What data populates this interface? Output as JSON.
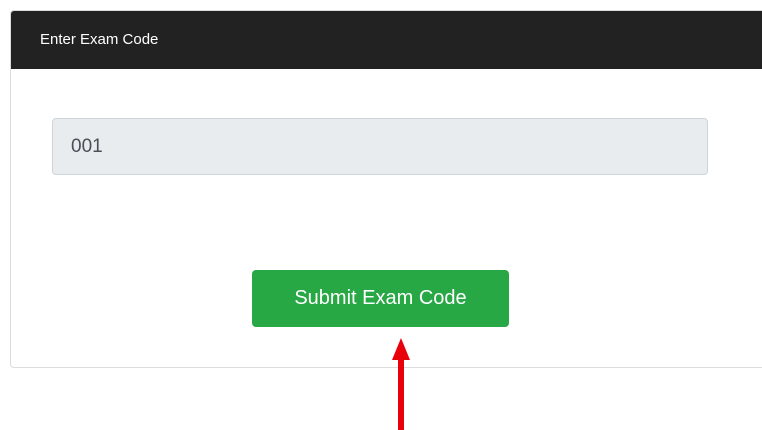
{
  "card": {
    "title": "Enter Exam Code"
  },
  "exam_code_field": {
    "value": "001"
  },
  "submit_button": {
    "label": "Submit Exam Code"
  },
  "annotation": {
    "icon": "arrow-up-icon",
    "color": "#e8000b"
  },
  "colors": {
    "header_background": "#222222",
    "button_background": "#28a745",
    "input_background": "#e9ecef"
  }
}
